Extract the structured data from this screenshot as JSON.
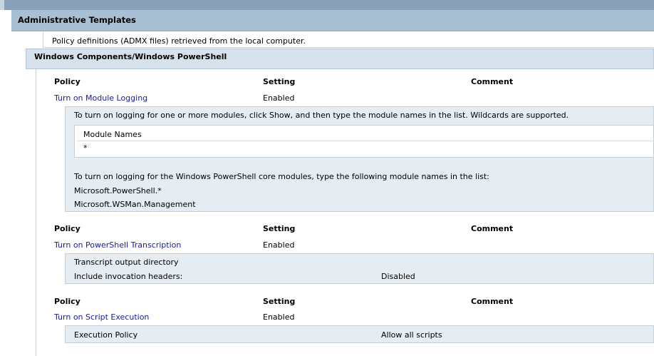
{
  "header": {
    "title": "Administrative Templates"
  },
  "admx_note": "Policy definitions (ADMX files) retrieved from the local computer.",
  "category": {
    "title": "Windows Components/Windows PowerShell"
  },
  "columns": {
    "policy": "Policy",
    "setting": "Setting",
    "comment": "Comment"
  },
  "policies": [
    {
      "name": "Turn on Module Logging",
      "setting": "Enabled",
      "description": "To turn on logging for one or more modules, click Show, and then type the module names in the list. Wildcards are supported.",
      "module_table_header": "Module Names",
      "module_table_value": "*",
      "core_note": "To turn on logging for the Windows PowerShell core modules, type the following module names in the list:",
      "core_modules": [
        "Microsoft.PowerShell.*",
        "Microsoft.WSMan.Management"
      ]
    },
    {
      "name": "Turn on PowerShell Transcription",
      "setting": "Enabled",
      "options": [
        {
          "label": "Transcript output directory",
          "value": ""
        },
        {
          "label": "Include invocation headers:",
          "value": "Disabled"
        }
      ]
    },
    {
      "name": "Turn on Script Execution",
      "setting": "Enabled",
      "options": [
        {
          "label": "Execution Policy",
          "value": "Allow all scripts"
        }
      ]
    }
  ]
}
